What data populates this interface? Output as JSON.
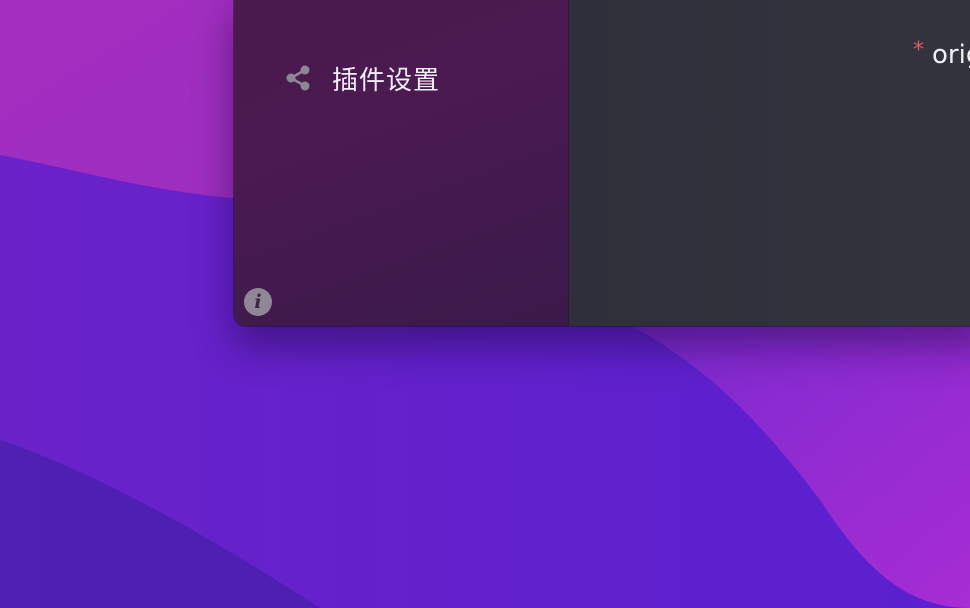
{
  "desktop": {
    "wallpaper": "purple-waves"
  },
  "window": {
    "sidebar": {
      "items": [
        {
          "label": "插件设置",
          "icon": "share-icon"
        }
      ],
      "info_icon": "info-icon"
    },
    "content": {
      "required_marker": "*",
      "field_label": "orig"
    }
  },
  "colors": {
    "sidebar_bg": "#4a1a4e",
    "content_bg": "#2f313b",
    "required": "#e05a5a",
    "icon_gray": "#8f8796"
  }
}
